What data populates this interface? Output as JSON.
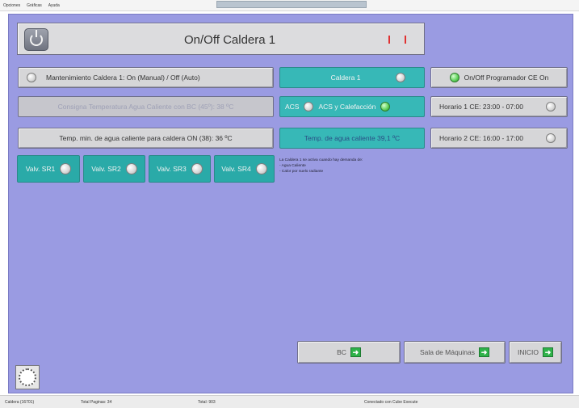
{
  "menu": [
    "Opciones",
    "Gráficas",
    "Ayuda"
  ],
  "header": {
    "title": "On/Off Caldera 1"
  },
  "buttons": {
    "mantenimiento": "Mantenimiento Caldera 1: On (Manual) / Off (Auto)",
    "caldera1": "Caldera 1",
    "programador": "On/Off Programador CE On",
    "consigna": "Consigna Temperatura Agua Caliente con BC (45º): 38 ºC",
    "acs": "ACS",
    "acs_calefaccion": "ACS y Calefacción",
    "horario1": "Horario 1 CE: 23:00 - 07:00",
    "temp_min": "Temp. min. de agua caliente para caldera ON (38): 36 ºC",
    "temp_agua": "Temp. de agua caliente 39,1 ºC",
    "horario2": "Horario 2 CE: 16:00 - 17:00",
    "valves": [
      "Valv. SR1",
      "Valv. SR2",
      "Valv. SR3",
      "Valv. SR4"
    ]
  },
  "info": [
    "La Caldera 1 se activa cuando hay demanda de:",
    "- Agua Caliente",
    "- Calor por suelo radiante"
  ],
  "nav": {
    "bc": "BC",
    "sala": "Sala de Máquinas",
    "inicio": "INICIO"
  },
  "status": {
    "left": "Caldera (16701)",
    "pages": "Total Paginas: 34",
    "total": "Total: 903",
    "connection": "Conectado con Cube Execute"
  },
  "colors": {
    "panel": "#9a9be2",
    "teal": "#37b8b7",
    "green": "#2fb24a",
    "red": "#e03131"
  },
  "icons": [
    "power-icon",
    "toggle-knob-icon",
    "arrow-right-icon",
    "clock-icon"
  ]
}
